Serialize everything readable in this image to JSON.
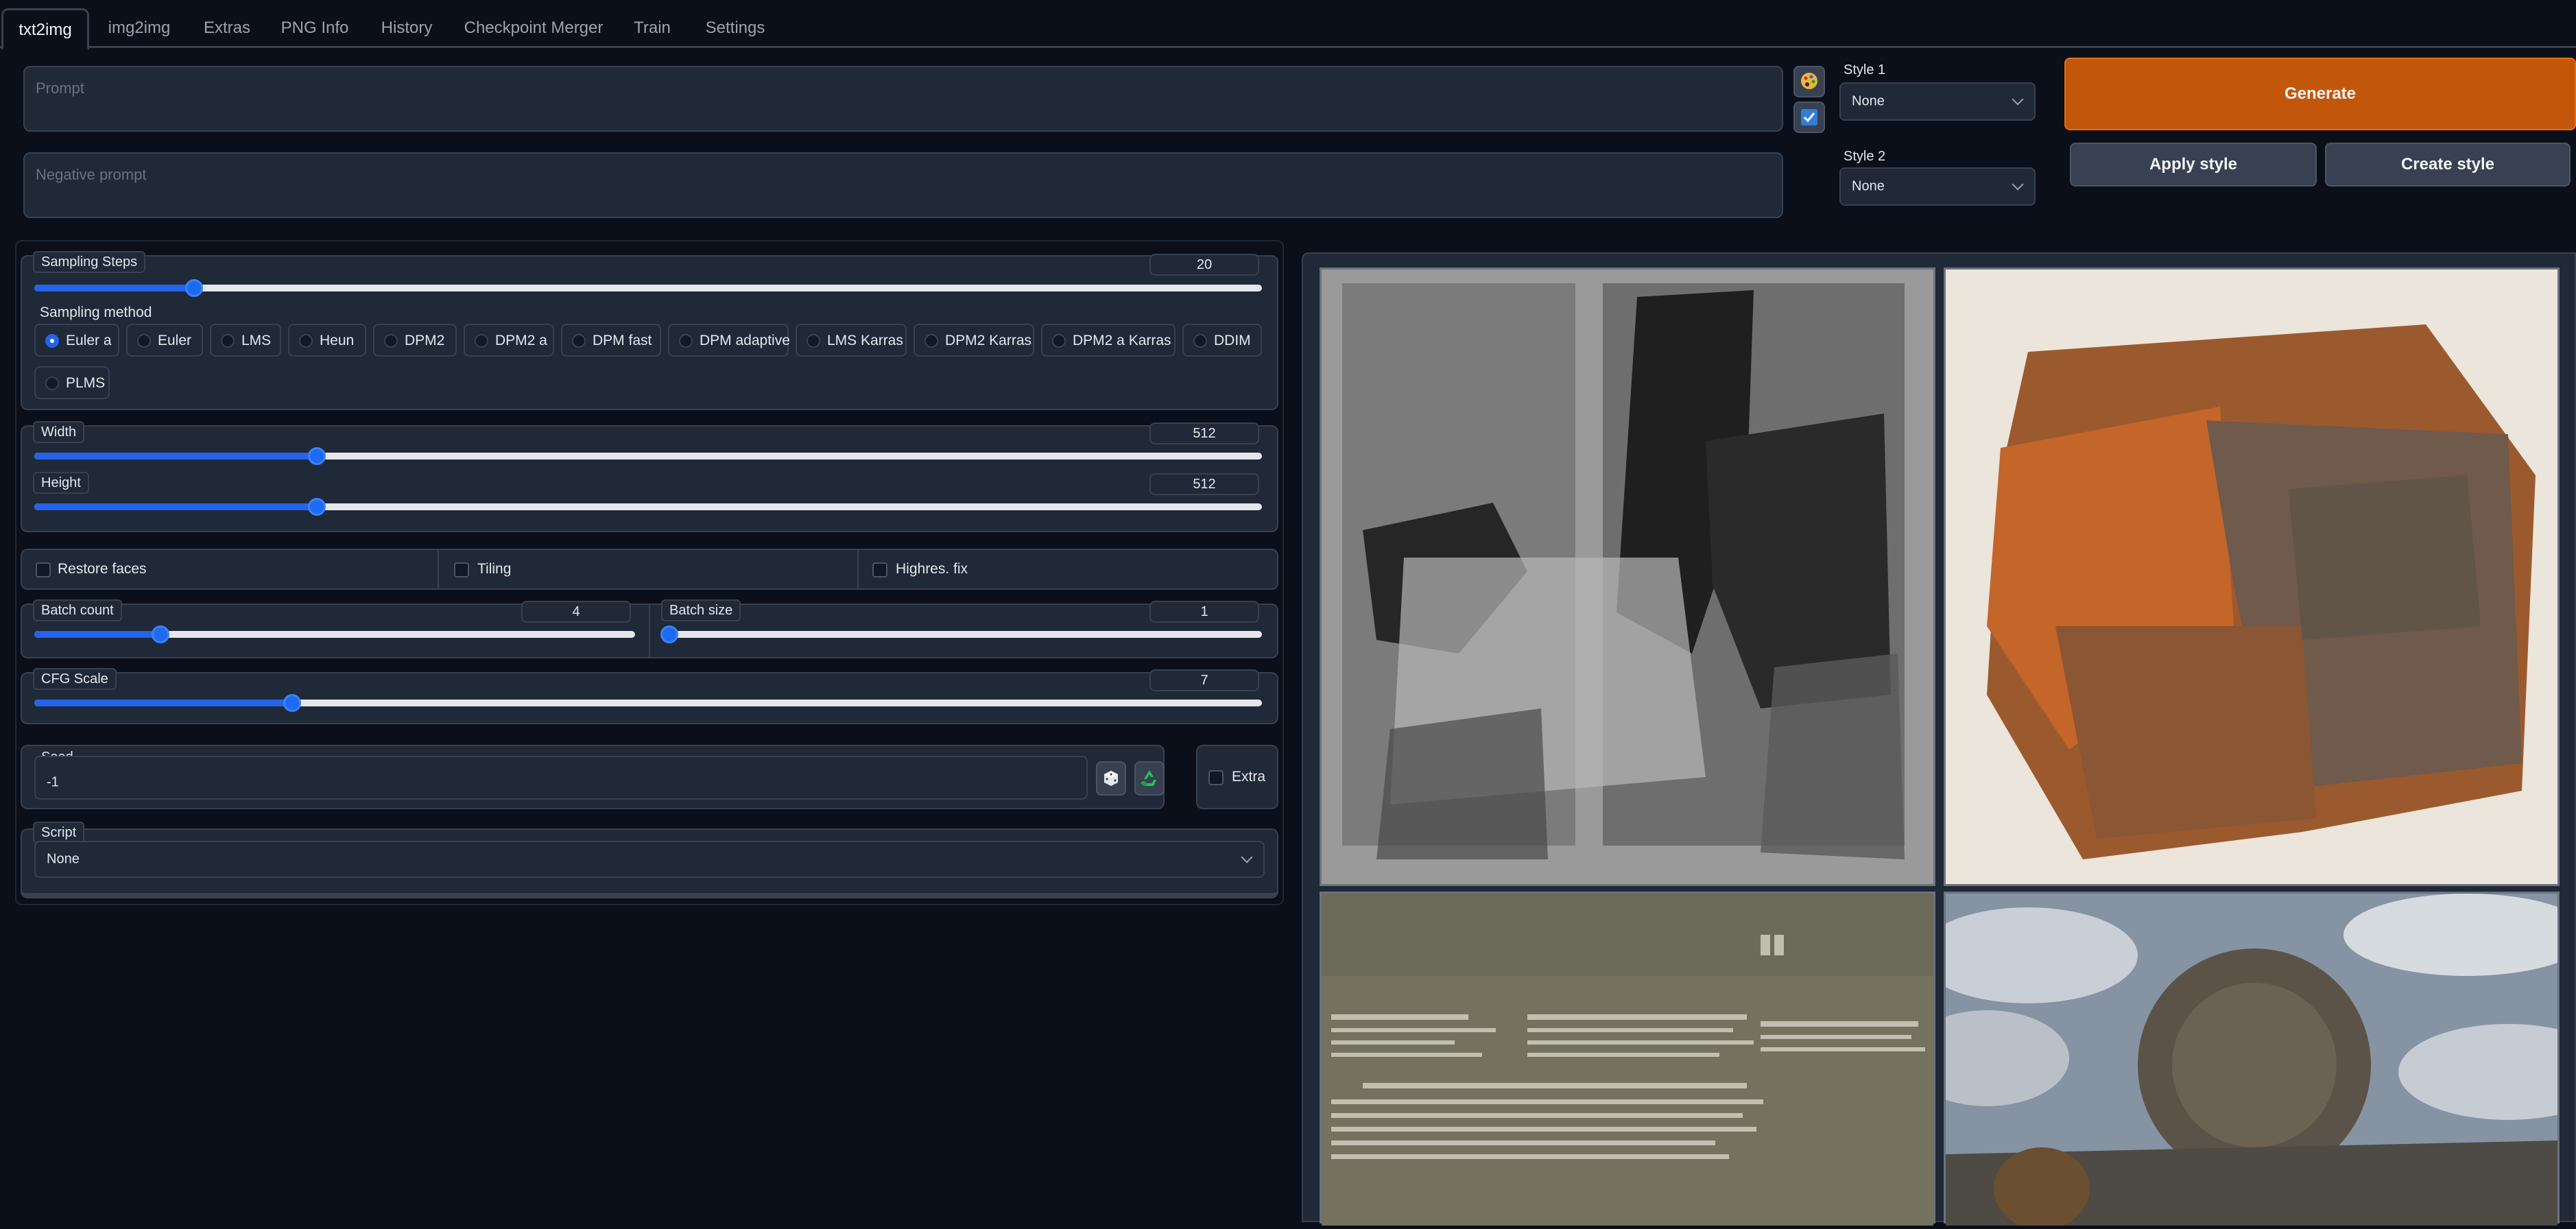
{
  "tabs": [
    "txt2img",
    "img2img",
    "Extras",
    "PNG Info",
    "History",
    "Checkpoint Merger",
    "Train",
    "Settings"
  ],
  "prompt": {
    "placeholder": "Prompt",
    "value": ""
  },
  "negative_prompt": {
    "placeholder": "Negative prompt",
    "value": ""
  },
  "styles": {
    "style1_label": "Style 1",
    "style1_value": "None",
    "style2_label": "Style 2",
    "style2_value": "None"
  },
  "buttons": {
    "generate": "Generate",
    "apply_style": "Apply style",
    "create_style": "Create style"
  },
  "sampling_steps": {
    "label": "Sampling Steps",
    "value": "20",
    "fraction": 0.13
  },
  "sampling_method": {
    "label": "Sampling method",
    "options": [
      "Euler a",
      "Euler",
      "LMS",
      "Heun",
      "DPM2",
      "DPM2 a",
      "DPM fast",
      "DPM adaptive",
      "LMS Karras",
      "DPM2 Karras",
      "DPM2 a Karras",
      "DDIM",
      "PLMS"
    ],
    "selected": "Euler a"
  },
  "width": {
    "label": "Width",
    "value": "512",
    "fraction": 0.23
  },
  "height": {
    "label": "Height",
    "value": "512",
    "fraction": 0.23
  },
  "checkboxes": {
    "restore_faces": "Restore faces",
    "tiling": "Tiling",
    "highres_fix": "Highres. fix"
  },
  "batch_count": {
    "label": "Batch count",
    "value": "4",
    "fraction": 0.21
  },
  "batch_size": {
    "label": "Batch size",
    "value": "1",
    "fraction": 0.0
  },
  "cfg_scale": {
    "label": "CFG Scale",
    "value": "7",
    "fraction": 0.21
  },
  "seed": {
    "label": "Seed",
    "value": "-1",
    "extra_label": "Extra"
  },
  "script": {
    "label": "Script",
    "value": "None"
  },
  "icons": {
    "paste": "palette-icon",
    "save_prompt": "check-square-icon",
    "random_seed": "dice-icon",
    "reuse_seed": "recycle-icon"
  }
}
